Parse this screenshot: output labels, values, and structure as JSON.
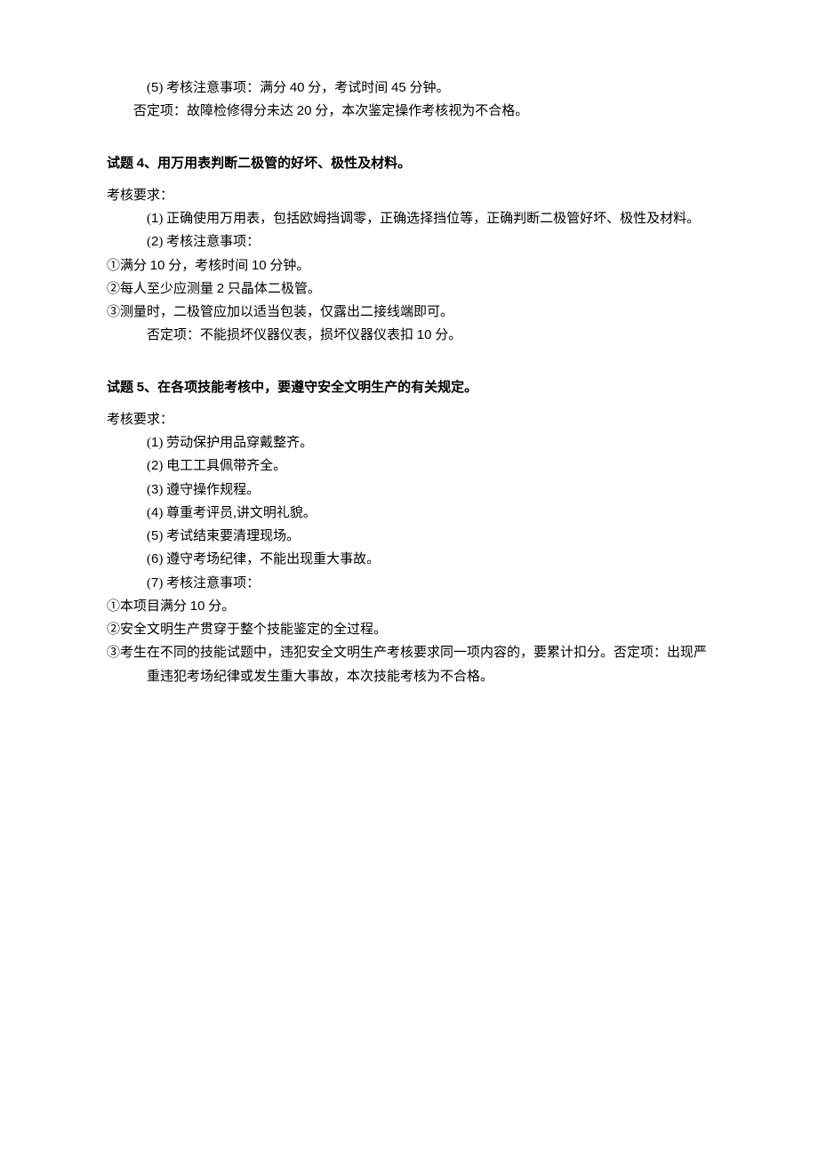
{
  "section3": {
    "item5": "(5) 考核注意事项：满分 40 分，考试时间 45 分钟。",
    "neg": "否定项：故障检修得分未达 20 分，本次鉴定操作考核视为不合格。"
  },
  "section4": {
    "title": "试题 4、用万用表判断二极管的好坏、极性及材料。",
    "reqLabel": "考核要求：",
    "item1": "(1) 正确使用万用表，包括欧姆挡调零，正确选择挡位等，正确判断二极管好坏、极性及材料。",
    "item2": "(2) 考核注意事项：",
    "n1": "①满分 10 分，考核时间 10 分钟。",
    "n2": "②每人至少应测量 2 只晶体二极管。",
    "n3": "③测量时，二极管应加以适当包装，仅露出二接线端即可。",
    "neg": "否定项：不能损坏仪器仪表，损坏仪器仪表扣 10 分。"
  },
  "section5": {
    "title": "试题 5、在各项技能考核中，要遵守安全文明生产的有关规定。",
    "reqLabel": "考核要求：",
    "item1": "(1) 劳动保护用品穿戴整齐。",
    "item2": "(2) 电工工具佩带齐全。",
    "item3": "(3) 遵守操作规程。",
    "item4": "(4) 尊重考评员,讲文明礼貌。",
    "item5": "(5) 考试结束要清理现场。",
    "item6": "(6) 遵守考场纪律，不能出现重大事故。",
    "item7": "(7) 考核注意事项：",
    "n1": "①本项目满分 10 分。",
    "n2": "②安全文明生产贯穿于整个技能鉴定的全过程。",
    "n3a": "③考生在不同的技能试题中，违犯安全文明生产考核要求同一项内容的，要累计扣分。否定项：出现严",
    "n3b": "重违犯考场纪律或发生重大事故，本次技能考核为不合格。"
  }
}
